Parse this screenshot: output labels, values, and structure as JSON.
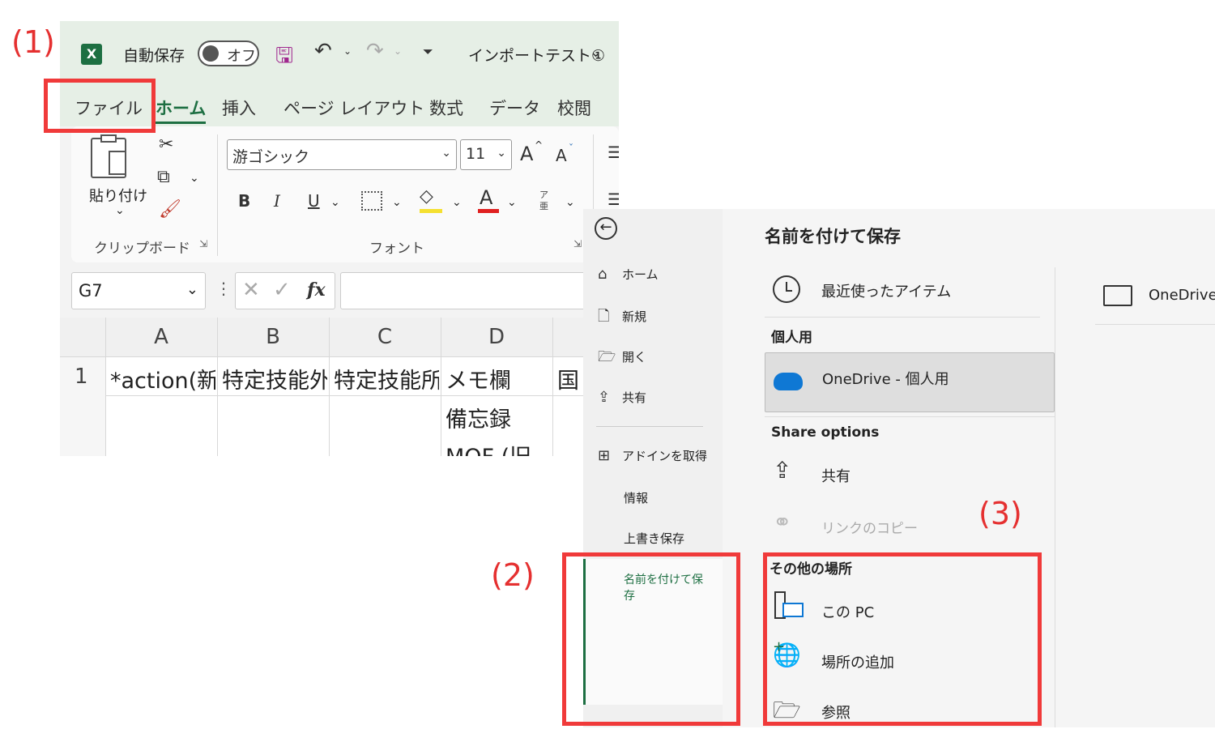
{
  "annotations": {
    "step1": "(1)",
    "step2": "(2)",
    "step3": "(3)"
  },
  "titlebar": {
    "autosave_label": "自動保存",
    "autosave_state": "オフ",
    "document_name": "インポートテスト①"
  },
  "tabs": [
    "ファイル",
    "ホーム",
    "挿入",
    "ページ レイアウト",
    "数式",
    "データ",
    "校閲"
  ],
  "ribbon": {
    "paste_label": "貼り付け",
    "clipboard_group": "クリップボード",
    "font_name": "游ゴシック",
    "font_size": "11",
    "font_group": "フォント",
    "bold": "B",
    "italic": "I",
    "underline": "U",
    "grow_font": "A",
    "shrink_font": "A",
    "font_color_glyph": "A",
    "phonetic_glyph": "ア亜"
  },
  "formula_bar": {
    "name_box": "G7",
    "fx": "fx",
    "value": ""
  },
  "grid": {
    "columns": [
      "A",
      "B",
      "C",
      "D"
    ],
    "rows": [
      {
        "num": "1",
        "cells": [
          "*action(新",
          "特定技能外",
          "特定技能所",
          "メモ欄",
          "国"
        ]
      },
      {
        "num": "",
        "cells": [
          "",
          "",
          "",
          "備忘録",
          ""
        ]
      },
      {
        "num": "",
        "cells": [
          "",
          "",
          "",
          "MOF (旧",
          ""
        ]
      }
    ]
  },
  "backstage": {
    "nav": {
      "home": "ホーム",
      "new": "新規",
      "open": "開く",
      "share": "共有",
      "addins": "アドインを取得",
      "info": "情報",
      "save": "上書き保存",
      "save_as": "名前を付けて保存"
    },
    "page_title": "名前を付けて保存",
    "recent": "最近使ったアイテム",
    "personal_header": "個人用",
    "onedrive_personal": "OneDrive - 個人用",
    "share_options_header": "Share options",
    "share": "共有",
    "copy_link": "リンクのコピー",
    "other_locations_header": "その他の場所",
    "this_pc": "この PC",
    "add_place": "場所の追加",
    "browse": "参照",
    "right_folder": "OneDrive"
  },
  "colors": {
    "excel_green": "#1d6f42",
    "annotation_red": "#f03a3a",
    "onedrive_blue": "#0f78d4"
  }
}
